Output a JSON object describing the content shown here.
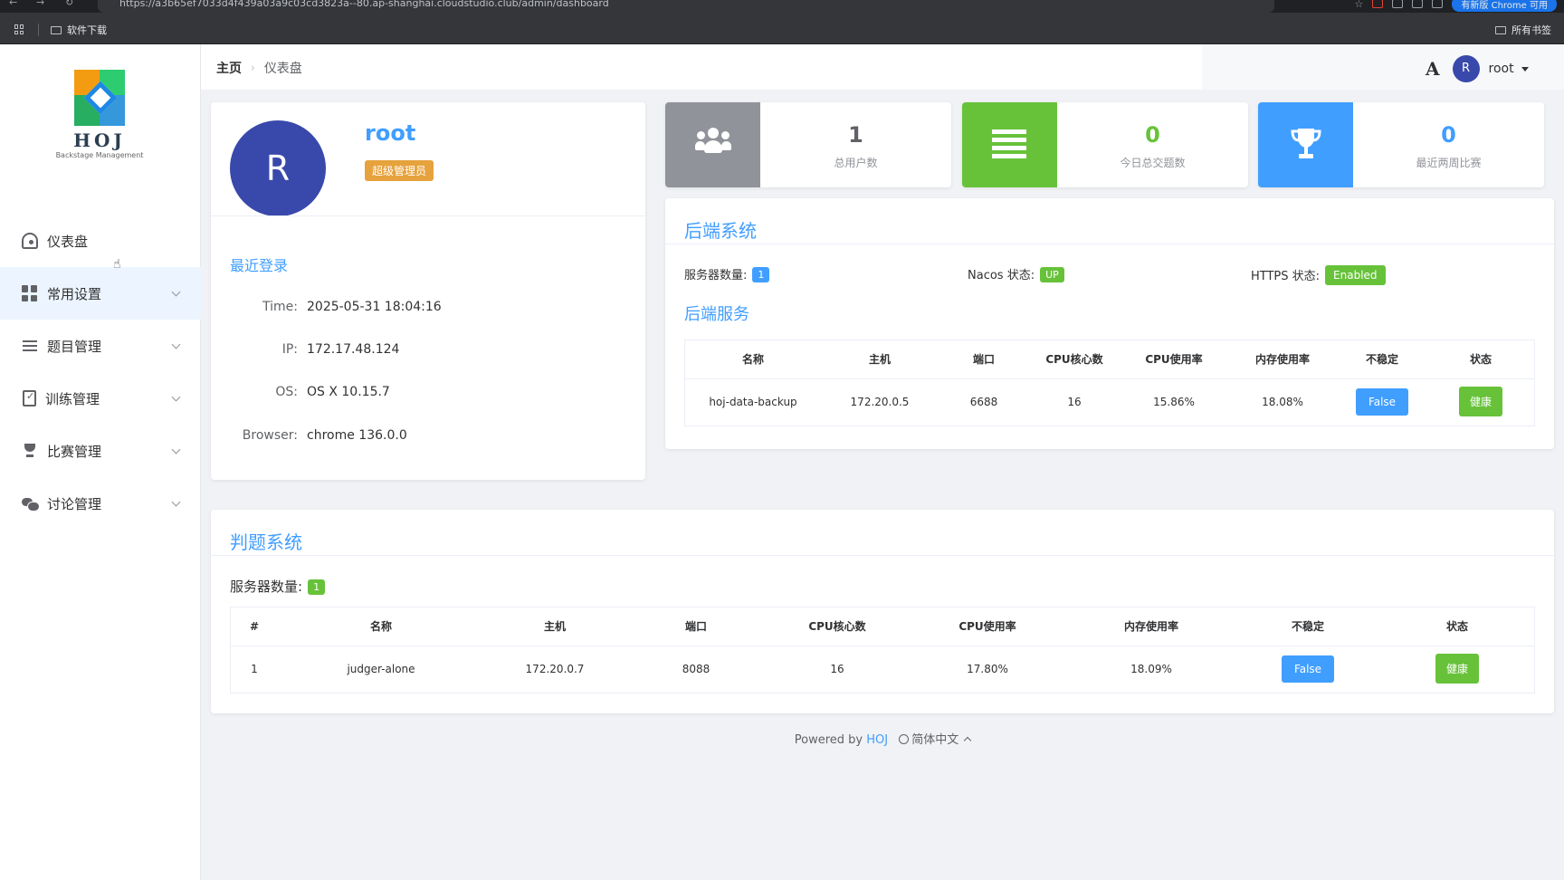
{
  "browser": {
    "url": "https://a3b65ef7033d4f439a03a9c03cd3823a--80.ap-shanghai.cloudstudio.club/admin/dashboard",
    "bookmark_folder": "软件下载",
    "all_bookmarks": "所有书签",
    "update_label": "有新版 Chrome 可用"
  },
  "sidebar": {
    "logo_text": "HOJ",
    "logo_sub": "Backstage Management",
    "items": [
      {
        "label": "仪表盘",
        "icon": "dashboard-icon"
      },
      {
        "label": "常用设置",
        "icon": "grid-icon"
      },
      {
        "label": "题目管理",
        "icon": "list-icon"
      },
      {
        "label": "训练管理",
        "icon": "clipboard-icon"
      },
      {
        "label": "比赛管理",
        "icon": "trophy-icon"
      },
      {
        "label": "讨论管理",
        "icon": "chat-icon"
      }
    ]
  },
  "header": {
    "breadcrumb_home": "主页",
    "breadcrumb_current": "仪表盘",
    "font_toggle": "A",
    "avatar_initial": "R",
    "username": "root"
  },
  "profile": {
    "avatar_initial": "R",
    "name": "root",
    "role": "超级管理员",
    "recent_login_title": "最近登录",
    "fields": [
      {
        "key": "Time:",
        "value": "2025-05-31 18:04:16"
      },
      {
        "key": "IP:",
        "value": "172.17.48.124"
      },
      {
        "key": "OS:",
        "value": "OS X 10.15.7"
      },
      {
        "key": "Browser:",
        "value": "chrome 136.0.0"
      }
    ]
  },
  "stats": [
    {
      "value": "1",
      "label": "总用户数",
      "color": "#909399",
      "value_color": "#606266",
      "icon": "users-icon"
    },
    {
      "value": "0",
      "label": "今日总交题数",
      "color": "#67c23a",
      "value_color": "#67c23a",
      "icon": "list-icon"
    },
    {
      "value": "0",
      "label": "最近两周比赛",
      "color": "#409eff",
      "value_color": "#409eff",
      "icon": "trophy-icon"
    }
  ],
  "backend": {
    "title": "后端系统",
    "server_count_label": "服务器数量:",
    "server_count": "1",
    "nacos_label": "Nacos 状态:",
    "nacos_status": "UP",
    "https_label": "HTTPS 状态:",
    "https_status": "Enabled",
    "services_title": "后端服务",
    "columns": [
      "名称",
      "主机",
      "端口",
      "CPU核心数",
      "CPU使用率",
      "内存使用率",
      "不稳定",
      "状态"
    ],
    "rows": [
      {
        "name": "hoj-data-backup",
        "host": "172.20.0.5",
        "port": "6688",
        "cores": "16",
        "cpu": "15.86%",
        "mem": "18.08%",
        "unstable": "False",
        "status": "健康"
      }
    ]
  },
  "judge": {
    "title": "判题系统",
    "server_count_label": "服务器数量:",
    "server_count": "1",
    "columns": [
      "#",
      "名称",
      "主机",
      "端口",
      "CPU核心数",
      "CPU使用率",
      "内存使用率",
      "不稳定",
      "状态"
    ],
    "rows": [
      {
        "index": "1",
        "name": "judger-alone",
        "host": "172.20.0.7",
        "port": "8088",
        "cores": "16",
        "cpu": "17.80%",
        "mem": "18.09%",
        "unstable": "False",
        "status": "健康"
      }
    ]
  },
  "footer": {
    "powered_by": "Powered by",
    "brand": "HOJ",
    "language": "简体中文"
  }
}
